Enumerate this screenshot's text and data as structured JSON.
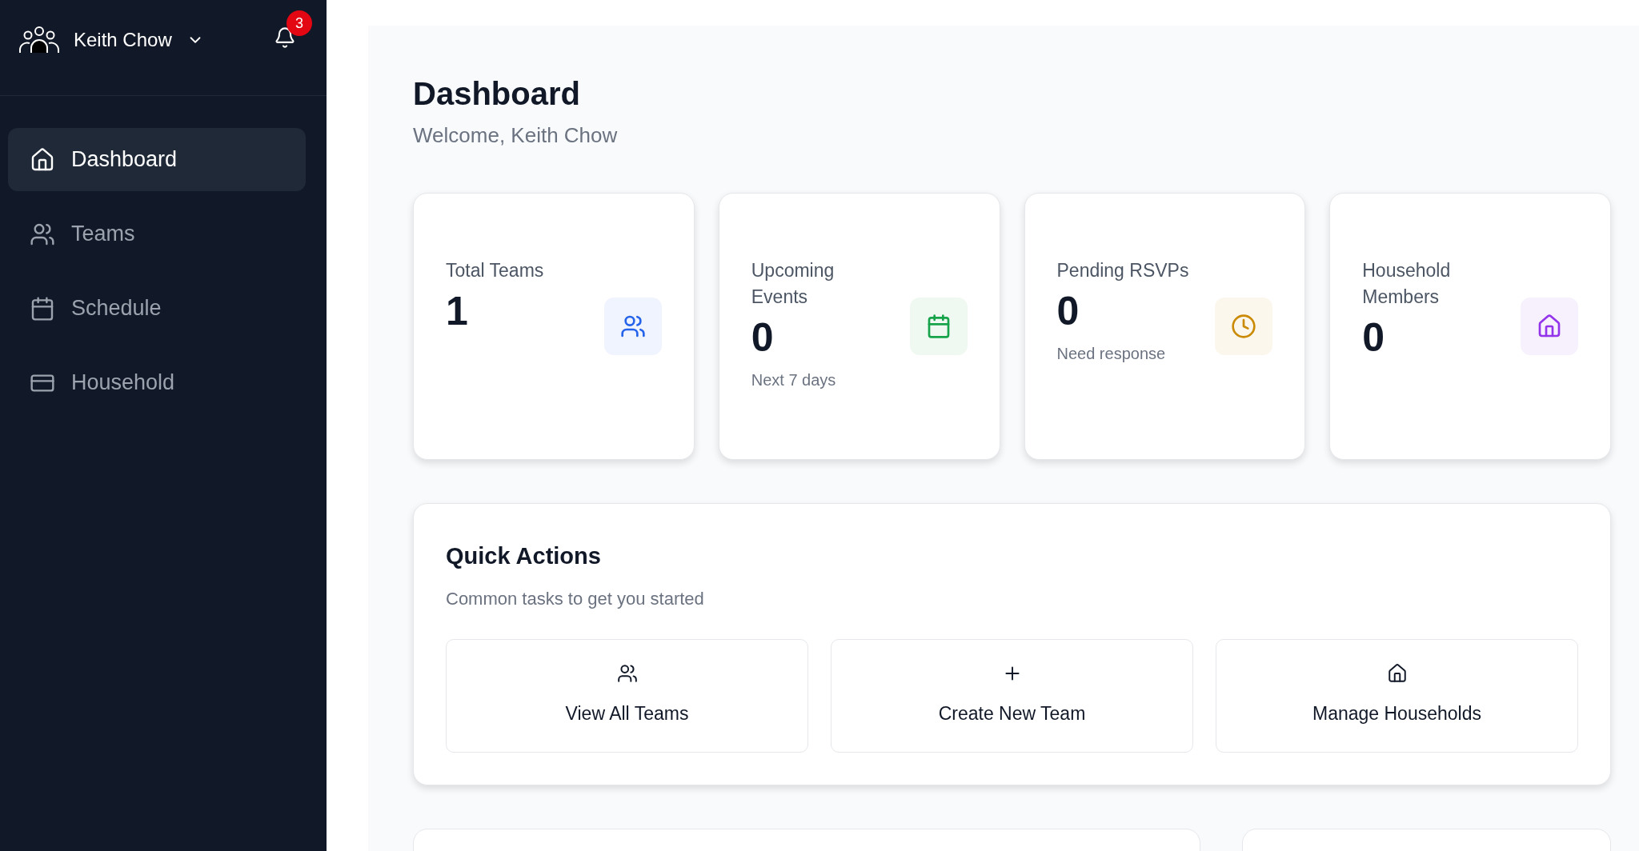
{
  "user": {
    "name": "Keith Chow",
    "notifications": "3"
  },
  "nav": [
    {
      "label": "Dashboard",
      "selected": true
    },
    {
      "label": "Teams",
      "selected": false
    },
    {
      "label": "Schedule",
      "selected": false
    },
    {
      "label": "Household",
      "selected": false
    }
  ],
  "page": {
    "title": "Dashboard",
    "subtitle": "Welcome, Keith Chow"
  },
  "stats": [
    {
      "label": "Total Teams",
      "value": "1",
      "color": "#2563eb"
    },
    {
      "label": "Upcoming Events",
      "value": "0",
      "note": "Next 7 days",
      "color": "#16a34a"
    },
    {
      "label": "Pending RSVPs",
      "value": "0",
      "note": "Need response",
      "color": "#ca8a04"
    },
    {
      "label": "Household Members",
      "value": "0",
      "color": "#9333ea"
    }
  ],
  "quick_actions": {
    "title": "Quick Actions",
    "subtitle": "Common tasks to get you started",
    "buttons": [
      "View All Teams",
      "Create New Team",
      "Manage Households"
    ]
  }
}
